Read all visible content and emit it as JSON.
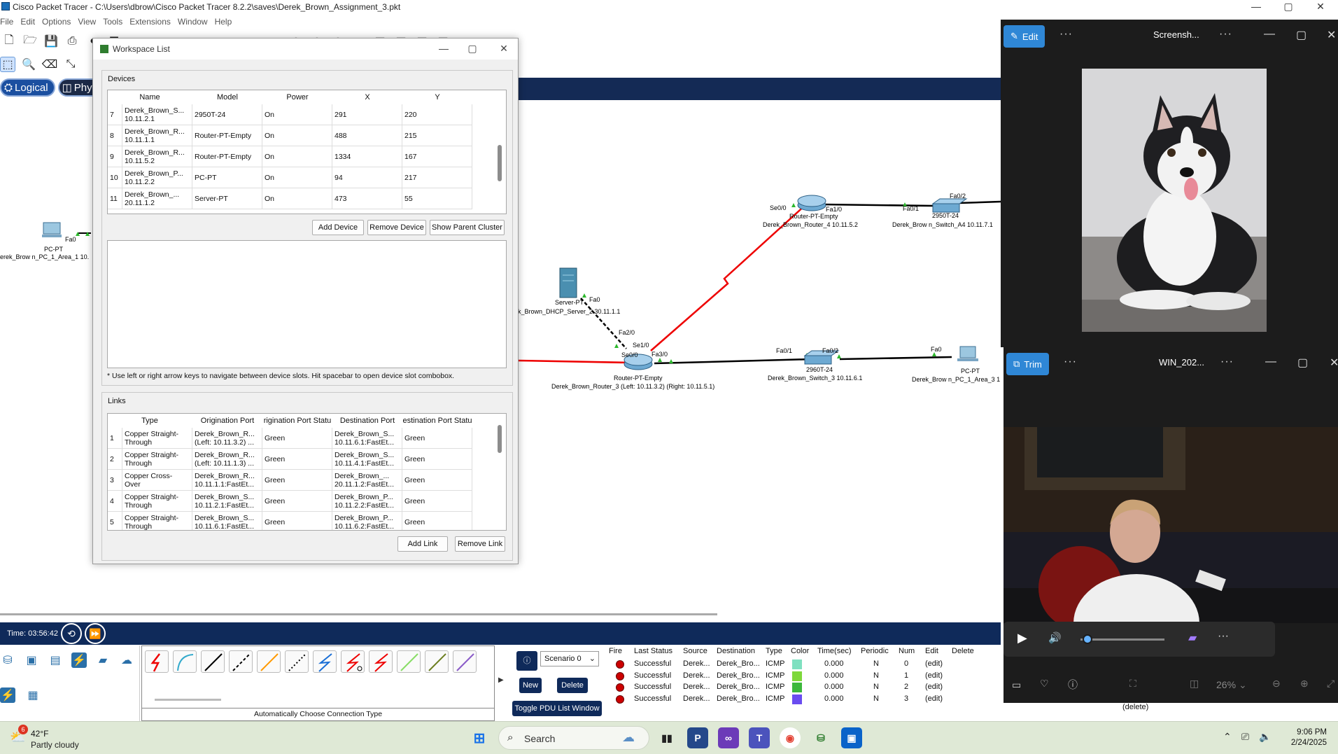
{
  "pt_window": {
    "title": "Cisco Packet Tracer - C:\\Users\\dbrow\\Cisco Packet Tracer 8.2.2\\saves\\Derek_Brown_Assignment_3.pkt",
    "menu": [
      "File",
      "Edit",
      "Options",
      "View",
      "Tools",
      "Extensions",
      "Window",
      "Help"
    ],
    "view_tabs": [
      "Logical",
      "Phys"
    ]
  },
  "workspace_list": {
    "title": "Workspace List",
    "devices_label": "Devices",
    "device_columns": [
      "Name",
      "Model",
      "Power",
      "X",
      "Y"
    ],
    "devices": [
      {
        "idx": "7",
        "name": "Derek_Brown_S...\n10.11.2.1",
        "model": "2950T-24",
        "power": "On",
        "x": "291",
        "y": "220"
      },
      {
        "idx": "8",
        "name": "Derek_Brown_R...\n10.11.1.1",
        "model": "Router-PT-Empty",
        "power": "On",
        "x": "488",
        "y": "215"
      },
      {
        "idx": "9",
        "name": "Derek_Brown_R...\n10.11.5.2",
        "model": "Router-PT-Empty",
        "power": "On",
        "x": "1334",
        "y": "167"
      },
      {
        "idx": "10",
        "name": "Derek_Brown_P...\n10.11.2.2",
        "model": "PC-PT",
        "power": "On",
        "x": "94",
        "y": "217"
      },
      {
        "idx": "11",
        "name": "Derek_Brown_...\n20.11.1.2",
        "model": "Server-PT",
        "power": "On",
        "x": "473",
        "y": "55"
      }
    ],
    "add_device": "Add Device",
    "remove_device": "Remove Device",
    "show_parent_cluster": "Show Parent Cluster",
    "hint": "* Use left or right arrow keys to navigate between device slots.  Hit spacebar to open device slot combobox.",
    "links_label": "Links",
    "link_columns": [
      "Type",
      "Origination Port",
      "rigination Port Statu",
      "Destination Port",
      "estination Port Statu"
    ],
    "links": [
      {
        "idx": "1",
        "type": "Copper Straight-\nThrough",
        "orig": "Derek_Brown_R...\n(Left: 10.11.3.2) ...",
        "orig_status": "Green",
        "dest": "Derek_Brown_S...\n10.11.6.1:FastEt...",
        "dest_status": "Green"
      },
      {
        "idx": "2",
        "type": "Copper Straight-\nThrough",
        "orig": "Derek_Brown_R...\n(Left: 10.11.1.3) ...",
        "orig_status": "Green",
        "dest": "Derek_Brown_S...\n10.11.4.1:FastEt...",
        "dest_status": "Green"
      },
      {
        "idx": "3",
        "type": "Copper Cross-\nOver",
        "orig": "Derek_Brown_R...\n10.11.1.1:FastEt...",
        "orig_status": "Green",
        "dest": "Derek_Brown_...\n20.11.1.2:FastEt...",
        "dest_status": "Green"
      },
      {
        "idx": "4",
        "type": "Copper Straight-\nThrough",
        "orig": "Derek_Brown_S...\n10.11.2.1:FastEt...",
        "orig_status": "Green",
        "dest": "Derek_Brown_P...\n10.11.2.2:FastEt...",
        "dest_status": "Green"
      },
      {
        "idx": "5",
        "type": "Copper Straight-\nThrough",
        "orig": "Derek_Brown_S...\n10.11.6.1:FastEt...",
        "orig_status": "Green",
        "dest": "Derek_Brown_P...\n10.11.6.2:FastEt...",
        "dest_status": "Green"
      }
    ],
    "add_link": "Add Link",
    "remove_link": "Remove Link"
  },
  "topology": {
    "pc1": {
      "type": "PC-PT",
      "port": "Fa0",
      "name": "erek_Brow n_PC_1_Area_1 10."
    },
    "server": {
      "type": "Server-PT",
      "port": "Fa0",
      "name": "k_Brown_DHCP_Server_2 30.11.1.1"
    },
    "router3": {
      "type": "Router-PT-Empty",
      "name": "Derek_Brown_Router_3 (Left: 10.11.3.2) (Right: 10.11.5.1)",
      "ports": {
        "fa2": "Fa2/0",
        "se1": "Se1/0",
        "se0": "Se0/0",
        "fa3": "Fa3/0"
      }
    },
    "router4": {
      "type": "Router-PT-Empty",
      "name": "Derek_Brown_Router_4 10.11.5.2",
      "ports": {
        "se0": "Se0/0",
        "fa1": "Fa1/0"
      }
    },
    "switch3": {
      "type": "2960T-24",
      "name": "Derek_Brown_Switch_3 10.11.6.1",
      "ports": {
        "fa1": "Fa0/1",
        "fa2": "Fa0/2"
      }
    },
    "switch4": {
      "type": "2950T-24",
      "name": "Derek_Brow n_Switch_A4 10.11.7.1",
      "ports": {
        "fa1": "Fa0/1",
        "fa2": "Fa0/2"
      }
    },
    "pc3": {
      "type": "PC-PT",
      "port": "Fa0",
      "name": "Derek_Brow n_PC_1_Area_3 1"
    }
  },
  "sim_bar": {
    "time": "Time: 03:56:42"
  },
  "connection_caption": "Automatically Choose Connection Type",
  "pdu": {
    "scenario": "Scenario 0",
    "new": "New",
    "delete": "Delete",
    "toggle": "Toggle PDU List Window",
    "columns": [
      "Fire",
      "Last Status",
      "Source",
      "Destination",
      "Type",
      "Color",
      "Time(sec)",
      "Periodic",
      "Num",
      "Edit",
      "Delete"
    ],
    "rows": [
      {
        "status": "Successful",
        "source": "Derek...",
        "dest": "Derek_Bro...",
        "type": "ICMP",
        "color": "#7fe0c0",
        "time": "0.000",
        "periodic": "N",
        "num": "0",
        "edit": "(edit)"
      },
      {
        "status": "Successful",
        "source": "Derek...",
        "dest": "Derek_Bro...",
        "type": "ICMP",
        "color": "#7ed83a",
        "time": "0.000",
        "periodic": "N",
        "num": "1",
        "edit": "(edit)"
      },
      {
        "status": "Successful",
        "source": "Derek...",
        "dest": "Derek_Bro...",
        "type": "ICMP",
        "color": "#3cb83c",
        "time": "0.000",
        "periodic": "N",
        "num": "2",
        "edit": "(edit)"
      },
      {
        "status": "Successful",
        "source": "Derek...",
        "dest": "Derek_Bro...",
        "type": "ICMP",
        "color": "#6a4cf0",
        "time": "0.000",
        "periodic": "N",
        "num": "3",
        "edit": "(edit)"
      }
    ],
    "delete_label": "(delete)"
  },
  "photos_top": {
    "edit": "Edit",
    "title": "Screensh..."
  },
  "photos_bottom": {
    "trim": "Trim",
    "title": "WIN_202...",
    "zoom": "26%"
  },
  "taskbar": {
    "temp": "42°F",
    "condition": "Partly cloudy",
    "badge": "6",
    "search": "Search",
    "time": "9:06 PM",
    "date": "2/24/2025"
  }
}
